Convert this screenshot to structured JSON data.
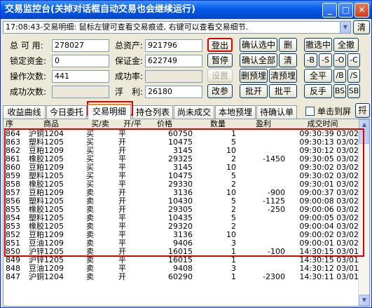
{
  "window": {
    "title": "交易监控台(关掉对话框自动交易也会继续运行)",
    "min_glyph": "_",
    "max_glyph": "□",
    "close_glyph": "✕"
  },
  "message": {
    "text": "17:08:43-交易明细: 鼠标左键可查看交易痕迹, 右键可以查看交易细节.",
    "clear_label": "清"
  },
  "fields": {
    "available_label": "总 可 用:",
    "available_value": "278027",
    "locked_label": "锁定资金:",
    "locked_value": "0",
    "ops_label": "操作次数:",
    "ops_value": "441",
    "success_label": "成功次数:",
    "success_value": "",
    "total_assets_label": "总资产:",
    "total_assets_value": "921796",
    "margin_label": "保证金:",
    "margin_value": "622749",
    "success_rate_label": "成功率:",
    "success_rate_value": "",
    "floating_label": "浮　利:",
    "floating_value": "26180"
  },
  "buttons": {
    "logout": "登出",
    "pause": "暂停",
    "settings": "设置",
    "modify": "改参",
    "confirm_selected": "确认选中",
    "confirm_all": "确认全部",
    "delete": "删",
    "clear": "清",
    "delete_pending": "删预埋",
    "clear_pending": "清预埋",
    "batch_open": "批开",
    "batch_close": "批平",
    "cancel_selected": "撤选中",
    "cancel_all": "全撤",
    "minus_b": "-B",
    "minus_s": "-S",
    "minus_o": "-O",
    "minus_c": "-C",
    "close_all": "全平",
    "slash_b": "/B",
    "slash_s": "/S",
    "reverse": "反手",
    "bs": "BS",
    "sb": "SB"
  },
  "tabs": [
    "收益曲线",
    "今日委托",
    "交易明细",
    "持仓列表",
    "尚未成交",
    "本地预埋",
    "待确认单"
  ],
  "active_tab": "交易明细",
  "top_checkbox_label": "单击到屏",
  "jump_label": "捋",
  "grid": {
    "headers": [
      "序",
      "商品",
      "买/卖",
      "开/平",
      "价格",
      "数量",
      "盈利",
      "成交时间"
    ],
    "rows": [
      [
        "864",
        "沪铜1204",
        "买",
        "平",
        "60750",
        "1",
        "",
        "09:30:39 03/02"
      ],
      [
        "863",
        "塑料1205",
        "买",
        "开",
        "10475",
        "5",
        "",
        "09:30:13 03/02"
      ],
      [
        "862",
        "豆粕1209",
        "买",
        "开",
        "3145",
        "10",
        "",
        "09:30:12 03/02"
      ],
      [
        "861",
        "橡胶1205",
        "买",
        "平",
        "29325",
        "2",
        "-1450",
        "09:30:05 03/02"
      ],
      [
        "860",
        "豆粕1209",
        "买",
        "平",
        "3145",
        "10",
        "",
        "09:30:02 03/02"
      ],
      [
        "859",
        "塑料1205",
        "买",
        "平",
        "10475",
        "5",
        "",
        "09:30:02 03/02"
      ],
      [
        "858",
        "橡胶1205",
        "买",
        "平",
        "29330",
        "2",
        "",
        "09:30:01 03/02"
      ],
      [
        "857",
        "豆粕1209",
        "卖",
        "开",
        "3136",
        "10",
        "-900",
        "09:00:37 03/02"
      ],
      [
        "856",
        "塑料1205",
        "卖",
        "开",
        "10430",
        "5",
        "-1125",
        "09:00:08 03/02"
      ],
      [
        "855",
        "橡胶1205",
        "卖",
        "开",
        "29305",
        "2",
        "-250",
        "09:00:06 03/02"
      ],
      [
        "854",
        "塑料1205",
        "卖",
        "平",
        "10435",
        "5",
        "",
        "09:00:05 03/02"
      ],
      [
        "853",
        "橡胶1205",
        "卖",
        "平",
        "29320",
        "2",
        "",
        "09:00:04 03/02"
      ],
      [
        "852",
        "豆粕1209",
        "卖",
        "平",
        "3136",
        "10",
        "",
        "09:00:02 03/02"
      ],
      [
        "851",
        "豆油1209",
        "卖",
        "平",
        "9406",
        "3",
        "",
        "09:00:01 03/02"
      ],
      [
        "850",
        "沪锌1205",
        "卖",
        "开",
        "16015",
        "1",
        "-100",
        "14:30:15 03/01"
      ],
      [
        "849",
        "沪锌1205",
        "卖",
        "平",
        "16015",
        "1",
        "",
        "14:30:15 03/01"
      ],
      [
        "848",
        "豆油1209",
        "卖",
        "平",
        "9408",
        "3",
        "",
        "14:30:12 03/01"
      ],
      [
        "847",
        "沪铜1204",
        "卖",
        "开",
        "60290",
        "1",
        "-2300",
        "14:30:11 03/01"
      ]
    ]
  }
}
